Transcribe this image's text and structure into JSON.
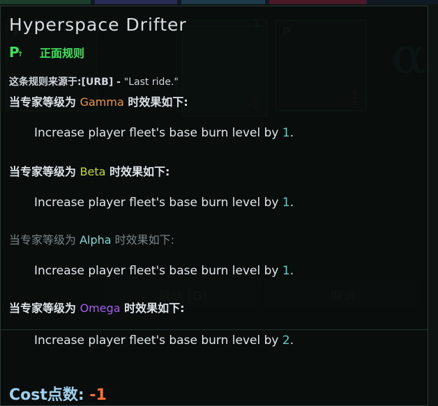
{
  "tooltip": {
    "title": "Hyperspace Drifter",
    "badge_letter": "P",
    "badge_arrow": "↑",
    "rule_type": "正面规则",
    "source_prefix": "这条规则来源于:",
    "source_code": "[URB]",
    "source_sep": " - ",
    "source_quote": "\"Last ride.\"",
    "tiers": [
      {
        "prefix": "当专家等级为 ",
        "name": "Gamma",
        "suffix": " 时效果如下:",
        "name_color": "#f0963a",
        "dimmed": false,
        "effect_text": "Increase player fleet's base burn level by ",
        "effect_value": "1",
        "effect_end": "."
      },
      {
        "prefix": "当专家等级为 ",
        "name": "Beta",
        "suffix": " 时效果如下:",
        "name_color": "#c8dc3c",
        "dimmed": false,
        "effect_text": "Increase player fleet's base burn level by ",
        "effect_value": "1",
        "effect_end": "."
      },
      {
        "prefix": "当专家等级为 ",
        "name": "Alpha",
        "suffix": " 时效果如下:",
        "name_color": "#7fdcd8",
        "dimmed": true,
        "effect_text": "Increase player fleet's base burn level by ",
        "effect_value": "1",
        "effect_end": "."
      },
      {
        "prefix": "当专家等级为 ",
        "name": "Omega",
        "suffix": " 时效果如下:",
        "name_color": "#a45cf0",
        "dimmed": false,
        "effect_text": "Increase player fleet's base burn level by ",
        "effect_value": "2",
        "effect_end": "."
      }
    ],
    "cost_label": "Cost点数: ",
    "cost_value": "-1"
  },
  "background": {
    "cards": [
      {
        "letter": "P",
        "number": ""
      },
      {
        "letter": "",
        "number": "1"
      },
      {
        "letter": "P",
        "number": "-1"
      },
      {
        "letter": "P",
        "number": "-1"
      }
    ],
    "alpha_glyph": "α",
    "confirm_label": "确认 [G]",
    "cancel_label": "取消"
  },
  "colors": {
    "accent_green": "#3fe35a",
    "cost_value": "#ff6f2e",
    "cost_label": "#9fd1ee",
    "effect_number": "#5fd0c8"
  }
}
